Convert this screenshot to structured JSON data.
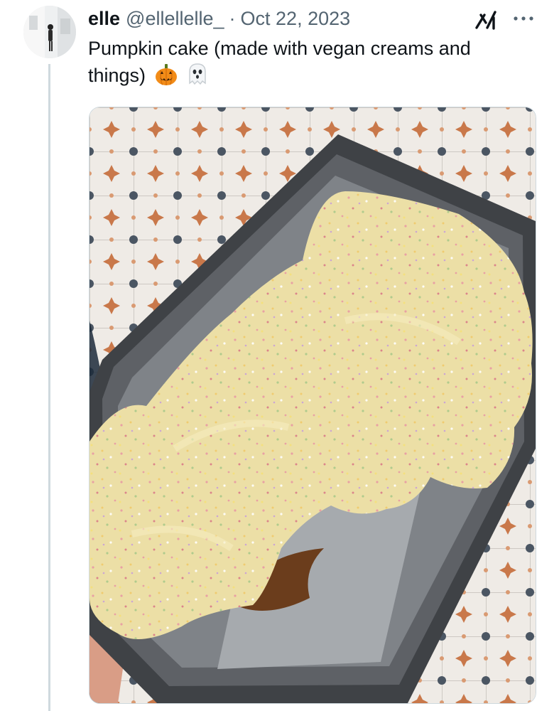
{
  "tweet": {
    "display_name": "elle",
    "handle": "@ellellelle_",
    "separator": "·",
    "date": "Oct 22, 2023",
    "text": "Pumpkin cake (made with vegan creams and things)",
    "emojis": [
      "jack-o-lantern",
      "ghost"
    ]
  },
  "icons": {
    "grok": "grok-icon",
    "more": "more-options-icon"
  },
  "colors": {
    "text": "#0f1419",
    "secondary": "#536471",
    "thread_line": "#cfd9de"
  }
}
